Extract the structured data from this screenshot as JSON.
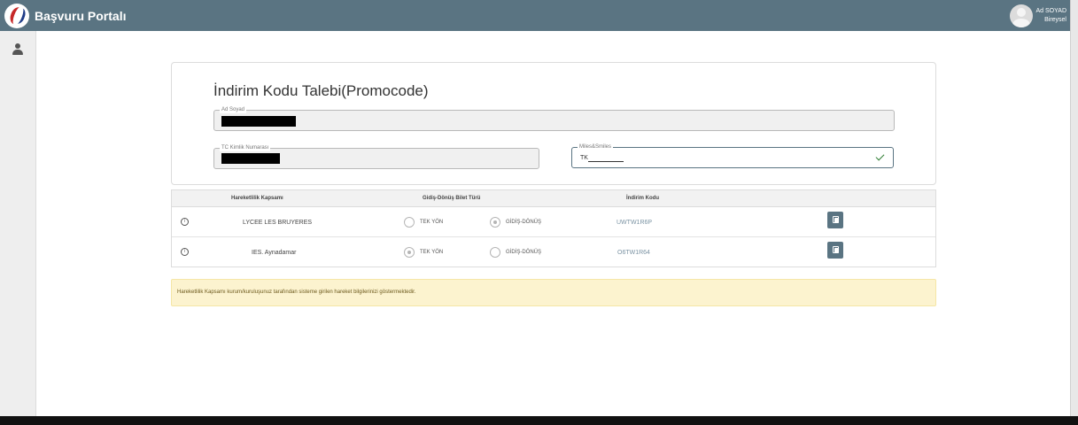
{
  "app": {
    "title": "Başvuru Portalı"
  },
  "user": {
    "name": "Ad SOYAD",
    "role": "Bireysel"
  },
  "sidebar": {
    "items": [
      {
        "icon": "user-icon"
      }
    ]
  },
  "form": {
    "title": "İndirim Kodu Talebi(Promocode)",
    "fields": {
      "ad_soyad": {
        "label": "Ad Soyad",
        "value": ""
      },
      "tc": {
        "label": "TC Kimlik Numarası",
        "value": ""
      },
      "miles": {
        "label": "Miles&Smiles",
        "value": "TK"
      }
    }
  },
  "table": {
    "headers": [
      "Hareketlilik Kapsamı",
      "Gidiş-Dönüş Bilet Türü",
      "İndirim Kodu"
    ],
    "rows": [
      {
        "kapsam": "LYCEE LES BRUYERES",
        "option1": "TEK YÖN",
        "option2": "GİDİŞ-DÖNÜŞ",
        "selected": "option2",
        "code": "UWTW1R6P"
      },
      {
        "kapsam": "IES. Aynadamar",
        "option1": "TEK YÖN",
        "option2": "GİDİŞ-DÖNÜŞ",
        "selected": "option1",
        "code": "O6TW1R64"
      }
    ]
  },
  "notice": {
    "text": "Hareketlilik Kapsamı kurum/kuruluşunuz tarafından sisteme girilen hareket bilgilerinizi göstermektedir."
  },
  "colors": {
    "header": "#5a7482",
    "notice_bg": "#fcf3cf",
    "code": "#7b93a3",
    "check": "#2e7d32"
  }
}
